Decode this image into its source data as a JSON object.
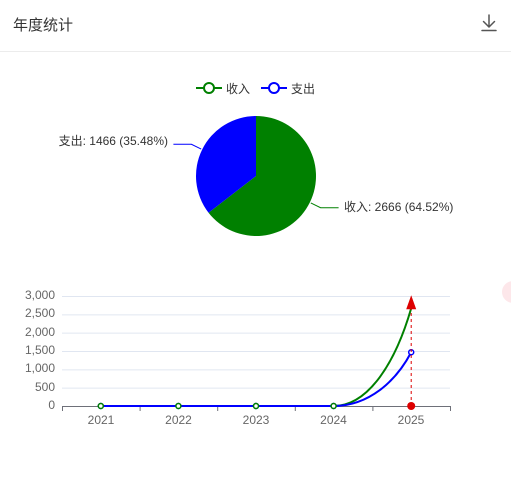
{
  "header": {
    "title": "年度统计",
    "download_icon": "download-icon"
  },
  "colors": {
    "income": "#008000",
    "expense": "#0000ff",
    "marker": "#dd0000"
  },
  "chart_data": [
    {
      "type": "pie",
      "legend": [
        "收入",
        "支出"
      ],
      "slices": [
        {
          "name": "收入",
          "value": 2666,
          "percent": 64.52,
          "label": "收入: 2666 (64.52%)"
        },
        {
          "name": "支出",
          "value": 1466,
          "percent": 35.48,
          "label": "支出: 1466 (35.48%)"
        }
      ]
    },
    {
      "type": "line",
      "categories": [
        "2021",
        "2022",
        "2023",
        "2024",
        "2025"
      ],
      "series": [
        {
          "name": "收入",
          "values": [
            0,
            0,
            0,
            0,
            2666
          ]
        },
        {
          "name": "支出",
          "values": [
            0,
            0,
            0,
            0,
            1466
          ]
        }
      ],
      "yticks": [
        "0",
        "500",
        "1,000",
        "1,500",
        "2,000",
        "2,500",
        "3,000"
      ],
      "ylim": [
        0,
        3000
      ],
      "grid": true,
      "marker_category": "2025"
    }
  ]
}
